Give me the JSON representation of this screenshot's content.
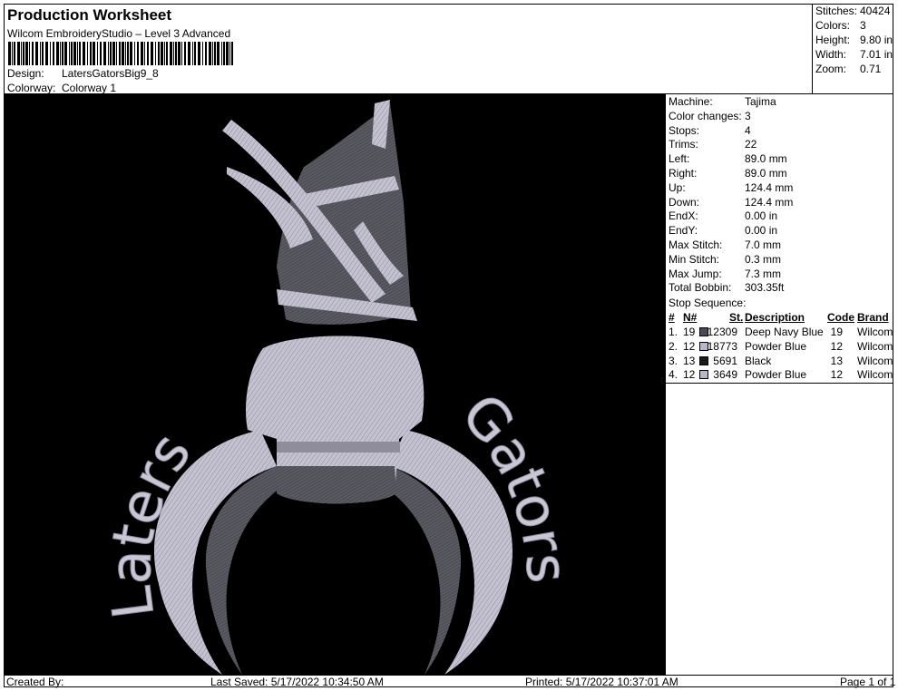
{
  "header": {
    "title": "Production Worksheet",
    "software": "Wilcom EmbroideryStudio – Level 3 Advanced",
    "design_label": "Design:",
    "design_value": "LatersGatorsBig9_8",
    "colorway_label": "Colorway:",
    "colorway_value": "Colorway 1"
  },
  "stats": [
    {
      "label": "Stitches:",
      "value": "40424"
    },
    {
      "label": "Colors:",
      "value": "3"
    },
    {
      "label": "Height:",
      "value": "9.80 in"
    },
    {
      "label": "Width:",
      "value": "7.01 in"
    },
    {
      "label": "Zoom:",
      "value": "0.71"
    }
  ],
  "machine_info": [
    {
      "label": "Machine:",
      "value": "Tajima"
    },
    {
      "label": "Color changes:",
      "value": "3"
    },
    {
      "label": "Stops:",
      "value": "4"
    },
    {
      "label": "Trims:",
      "value": "22"
    },
    {
      "label": "Left:",
      "value": "89.0 mm"
    },
    {
      "label": "Right:",
      "value": "89.0 mm"
    },
    {
      "label": "Up:",
      "value": "124.4 mm"
    },
    {
      "label": "Down:",
      "value": "124.4 mm"
    },
    {
      "label": "EndX:",
      "value": "0.00 in"
    },
    {
      "label": "EndY:",
      "value": "0.00 in"
    },
    {
      "label": "Max Stitch:",
      "value": "7.0 mm"
    },
    {
      "label": "Min Stitch:",
      "value": "0.3 mm"
    },
    {
      "label": "Max Jump:",
      "value": "7.3 mm"
    },
    {
      "label": "Total Bobbin:",
      "value": "303.35ft"
    }
  ],
  "stop_sequence": {
    "title": "Stop Sequence:",
    "headers": {
      "idx": "#",
      "n": "N#",
      "st": "St.",
      "desc": "Description",
      "code": "Code",
      "brand": "Brand"
    },
    "rows": [
      {
        "idx": "1.",
        "n": "19",
        "color": "#4a4a52",
        "st": "12309",
        "desc": "Deep Navy Blue",
        "code": "19",
        "brand": "Wilcom"
      },
      {
        "idx": "2.",
        "n": "12",
        "color": "#b8b6cc",
        "st": "18773",
        "desc": "Powder Blue",
        "code": "12",
        "brand": "Wilcom"
      },
      {
        "idx": "3.",
        "n": "13",
        "color": "#1a1a1a",
        "st": "5691",
        "desc": "Black",
        "code": "13",
        "brand": "Wilcom"
      },
      {
        "idx": "4.",
        "n": "12",
        "color": "#b8b6cc",
        "st": "3649",
        "desc": "Powder Blue",
        "code": "12",
        "brand": "Wilcom"
      }
    ]
  },
  "design_text": {
    "left_word": "Laters",
    "right_word": "Gators"
  },
  "footer": {
    "created_by": "Created By:",
    "last_saved": "Last Saved: 5/17/2022 10:34:50 AM",
    "printed": "Printed: 5/17/2022 10:37:01 AM",
    "page": "Page 1 of 1"
  }
}
